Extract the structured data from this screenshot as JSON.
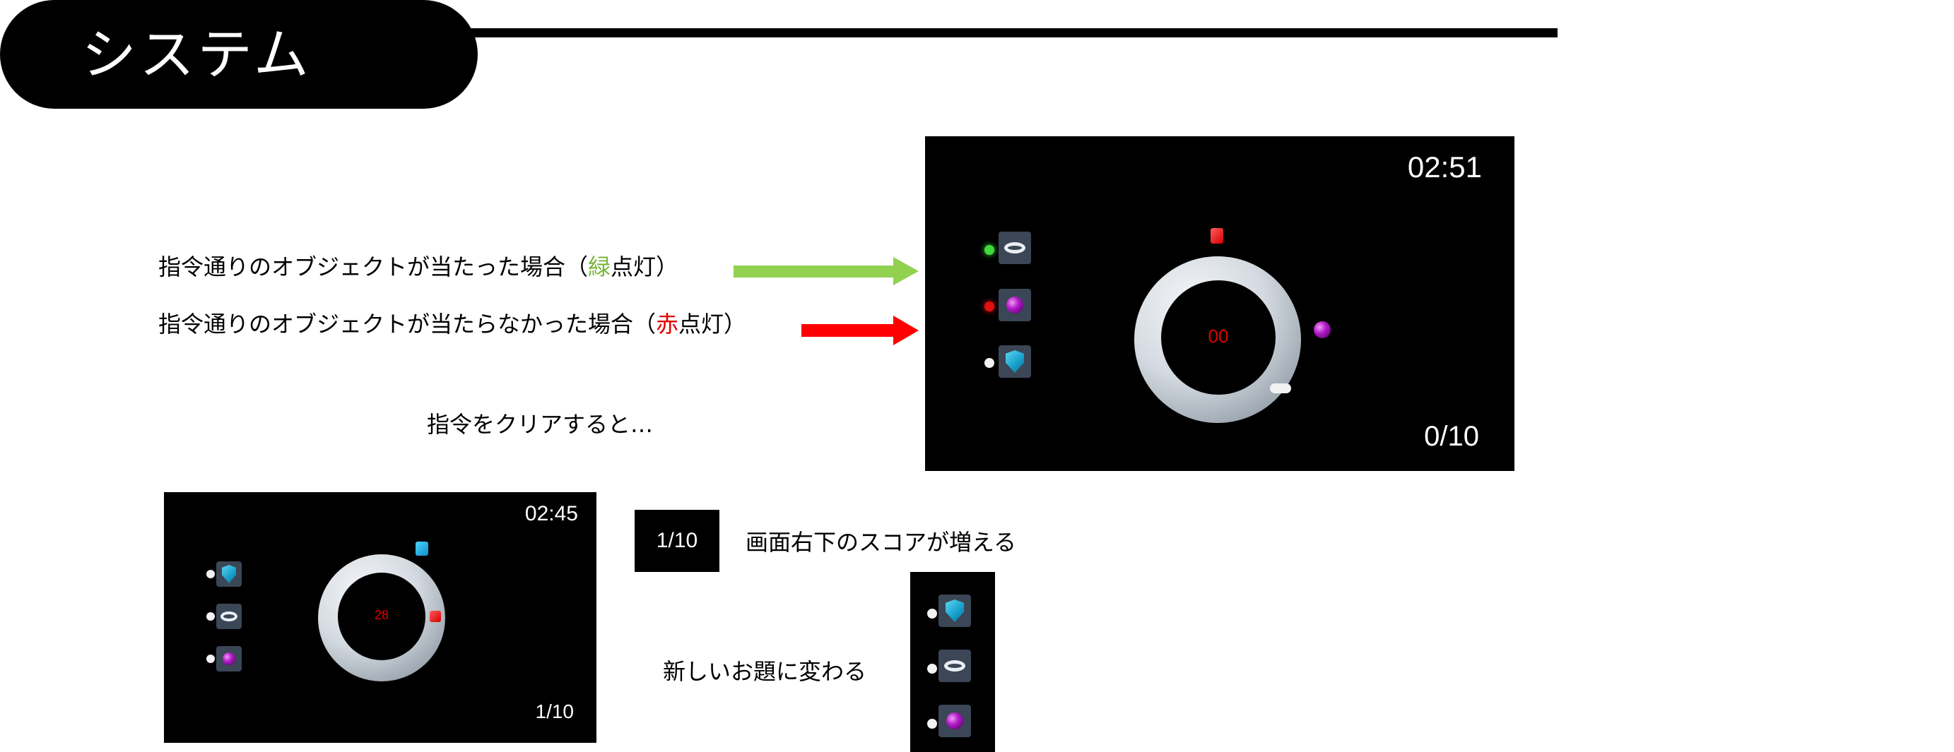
{
  "header": {
    "title": "システム"
  },
  "captions": {
    "hit_prefix": "指令通りのオブジェクトが当たった場合（",
    "hit_color_word": "緑",
    "hit_suffix": "点灯）",
    "miss_prefix": "指令通りのオブジェクトが当たらなかった場合（",
    "miss_color_word": "赤",
    "miss_suffix": "点灯）",
    "clear": "指令をクリアすると…",
    "score_up": "画面右下のスコアが増える",
    "new_task": "新しいお題に変わる"
  },
  "screen_large": {
    "timer": "02:51",
    "score": "0/10",
    "ring_count": "00",
    "slots": [
      {
        "led": "green",
        "icon": "torus-icon"
      },
      {
        "led": "red",
        "icon": "sphere-icon"
      },
      {
        "led": "white",
        "icon": "shield-icon"
      }
    ]
  },
  "screen_small": {
    "timer": "02:45",
    "score": "1/10",
    "ring_count": "28",
    "slots": [
      {
        "led": "white",
        "icon": "shield-icon"
      },
      {
        "led": "white",
        "icon": "torus-icon"
      },
      {
        "led": "white",
        "icon": "sphere-icon"
      }
    ]
  },
  "score_box": {
    "label": "1/10"
  },
  "new_slots": [
    {
      "led": "white",
      "icon": "shield-icon"
    },
    {
      "led": "white",
      "icon": "torus-icon"
    },
    {
      "led": "white",
      "icon": "sphere-icon"
    }
  ],
  "colors": {
    "hit_arrow": "#92d050",
    "miss_arrow": "#ff0000",
    "green_text": "#77b53a",
    "red_text": "#e00000"
  }
}
